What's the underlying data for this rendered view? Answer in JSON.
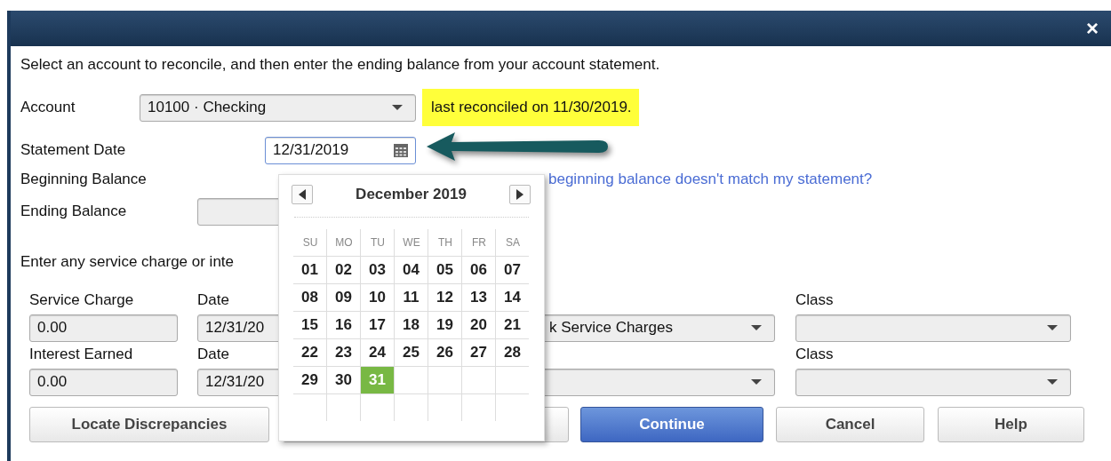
{
  "window": {
    "close": "×"
  },
  "instruction": "Select an account to reconcile, and then enter the ending balance from your account statement.",
  "account": {
    "label": "Account",
    "value": "10100 · Checking",
    "note": "last reconciled on 11/30/2019."
  },
  "statement_date": {
    "label": "Statement Date",
    "value": "12/31/2019"
  },
  "beginning_balance": {
    "label": "Beginning Balance"
  },
  "help_link": "beginning balance doesn't match my statement?",
  "ending_balance": {
    "label": "Ending Balance"
  },
  "charges_intro": "Enter any service charge or inte",
  "charges": [
    {
      "label": "Service Charge",
      "amount": "0.00",
      "date_label": "Date",
      "date": "12/31/20",
      "account": "k Service Charges",
      "class_label": "Class"
    },
    {
      "label": "Interest Earned",
      "amount": "0.00",
      "date_label": "Date",
      "date": "12/31/20",
      "class_label": "Class"
    }
  ],
  "buttons": [
    {
      "kind": "normal",
      "label": "Locate Discrepancies"
    },
    {
      "kind": "covered"
    },
    {
      "kind": "primary",
      "label": "Continue"
    },
    {
      "kind": "normal",
      "label": "Cancel"
    },
    {
      "kind": "normal",
      "label": "Help"
    }
  ],
  "calendar": {
    "month": "December 2019",
    "weekdays": [
      "SU",
      "MO",
      "TU",
      "WE",
      "TH",
      "FR",
      "SA"
    ],
    "weeks": [
      [
        {
          "day": "01",
          "selected": false
        },
        {
          "day": "02",
          "selected": false
        },
        {
          "day": "03",
          "selected": false
        },
        {
          "day": "04",
          "selected": false
        },
        {
          "day": "05",
          "selected": false
        },
        {
          "day": "06",
          "selected": false
        },
        {
          "day": "07",
          "selected": false
        }
      ],
      [
        {
          "day": "08",
          "selected": false
        },
        {
          "day": "09",
          "selected": false
        },
        {
          "day": "10",
          "selected": false
        },
        {
          "day": "11",
          "selected": false
        },
        {
          "day": "12",
          "selected": false
        },
        {
          "day": "13",
          "selected": false
        },
        {
          "day": "14",
          "selected": false
        }
      ],
      [
        {
          "day": "15",
          "selected": false
        },
        {
          "day": "16",
          "selected": false
        },
        {
          "day": "17",
          "selected": false
        },
        {
          "day": "18",
          "selected": false
        },
        {
          "day": "19",
          "selected": false
        },
        {
          "day": "20",
          "selected": false
        },
        {
          "day": "21",
          "selected": false
        }
      ],
      [
        {
          "day": "22",
          "selected": false
        },
        {
          "day": "23",
          "selected": false
        },
        {
          "day": "24",
          "selected": false
        },
        {
          "day": "25",
          "selected": false
        },
        {
          "day": "26",
          "selected": false
        },
        {
          "day": "27",
          "selected": false
        },
        {
          "day": "28",
          "selected": false
        }
      ],
      [
        {
          "day": "29",
          "selected": false
        },
        {
          "day": "30",
          "selected": false
        },
        {
          "day": "31",
          "selected": true
        }
      ]
    ]
  }
}
